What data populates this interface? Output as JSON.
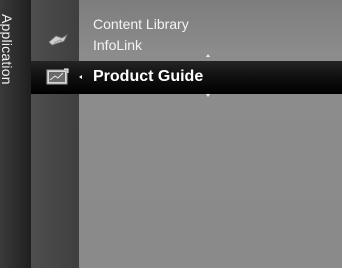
{
  "menu": {
    "category_label": "Application",
    "items": [
      {
        "label": "Content Library",
        "icon": "content-library-icon"
      },
      {
        "label": "InfoLink",
        "icon": "infolink-icon"
      }
    ],
    "selected": {
      "label": "Product Guide",
      "icon": "product-guide-icon"
    }
  },
  "colors": {
    "background": "#8a8a8a",
    "highlight": "#000000",
    "text": "#f4f4f4"
  }
}
